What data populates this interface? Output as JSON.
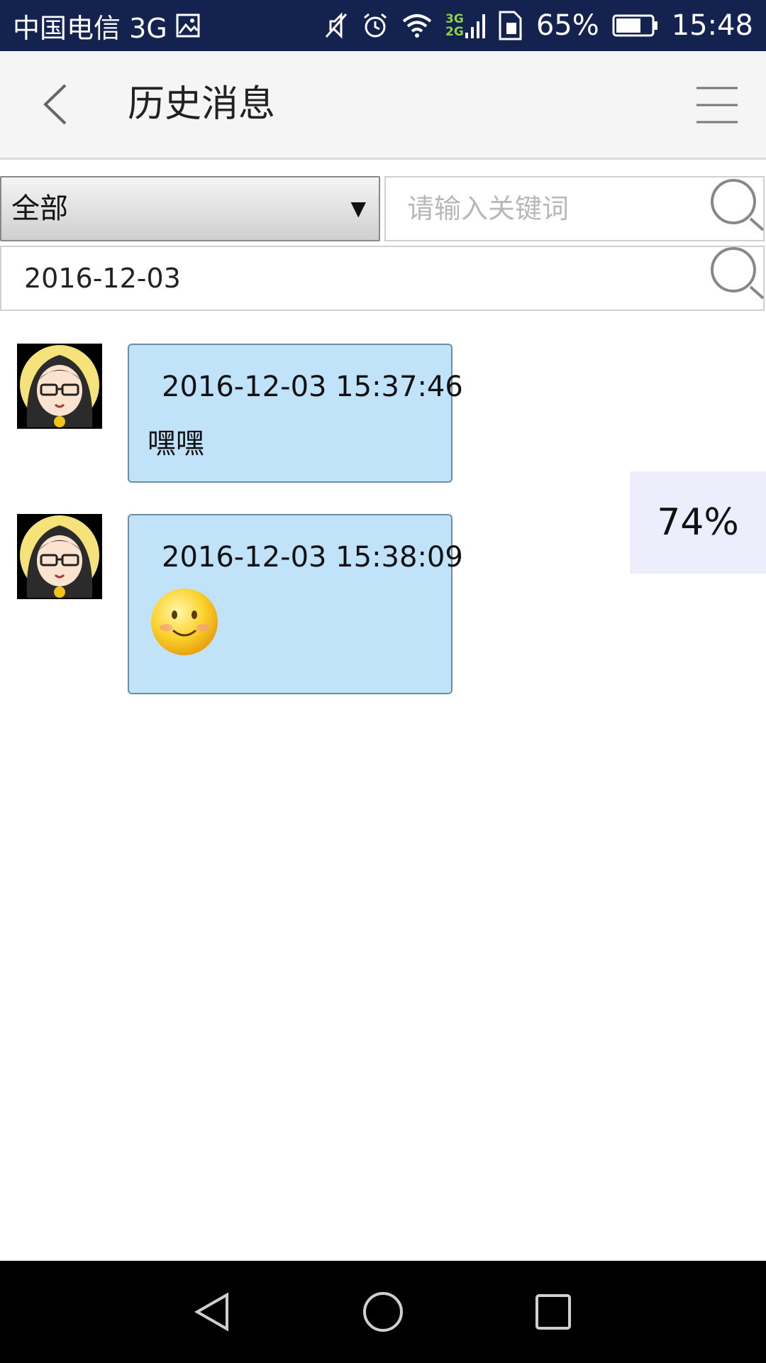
{
  "status_bar": {
    "carrier": "中国电信 3G",
    "net_top": "3G",
    "net_bottom": "2G",
    "battery": "65%",
    "time": "15:48",
    "icons": [
      "gallery-icon",
      "mute-icon",
      "alarm-icon",
      "wifi-icon",
      "signal-icon",
      "sim-icon",
      "battery-icon"
    ]
  },
  "header": {
    "title": "历史消息",
    "back_icon": "chevron-left-icon",
    "menu_icon": "hamburger-menu-icon"
  },
  "filter": {
    "category_selected": "全部",
    "dropdown_arrow": "▼",
    "keyword_placeholder": "请输入关键词",
    "date_value": "2016-12-03"
  },
  "messages": [
    {
      "time": "2016-12-03 15:37:46",
      "text": "嘿嘿",
      "emoji": ""
    },
    {
      "time": "2016-12-03 15:38:09",
      "text": "",
      "emoji": "smiley-emoji"
    }
  ],
  "overlay": {
    "percent": "74%"
  },
  "colors": {
    "status_bar": "#13224f",
    "bubble": "#c1e3fa",
    "bubble_border": "#6d8ea6",
    "percent_bg": "#ededfb"
  }
}
